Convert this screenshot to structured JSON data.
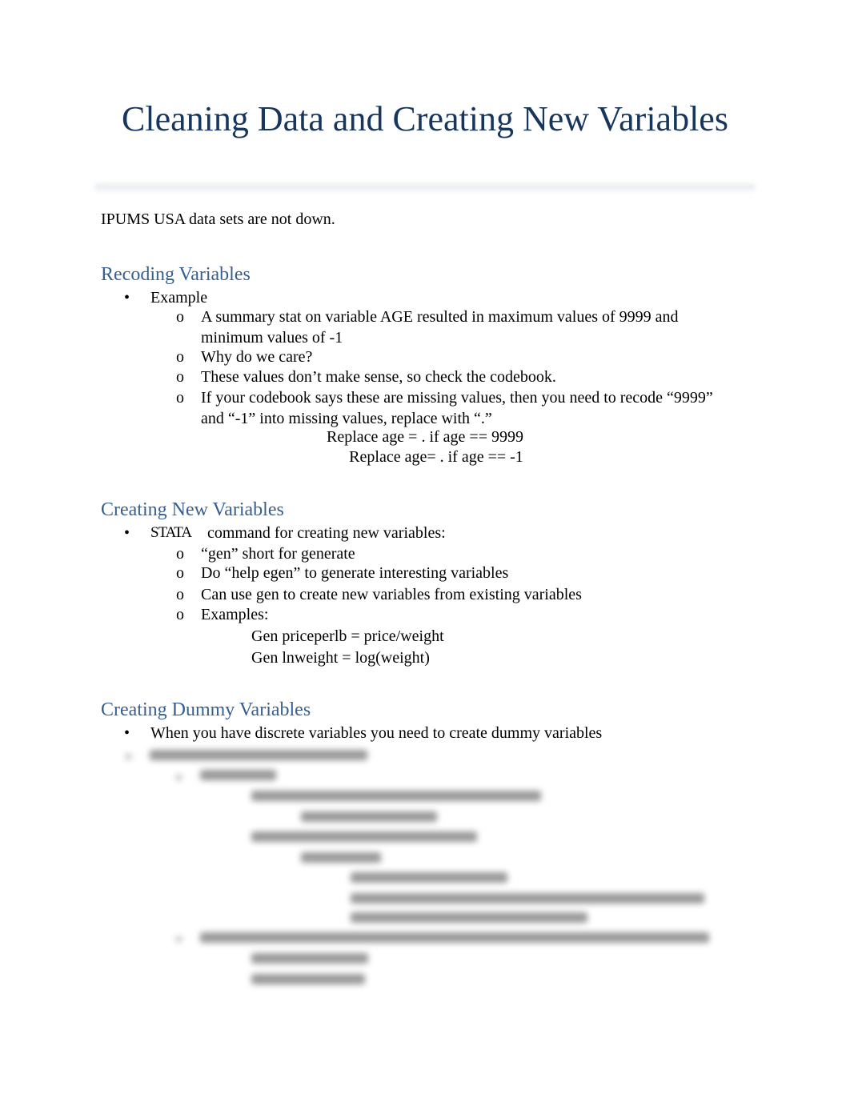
{
  "document": {
    "title": "Cleaning Data and Creating New Variables",
    "intro": "IPUMS USA data sets are not down.",
    "sections": [
      {
        "heading": "Recoding Variables",
        "bullet_glyph": "•",
        "sub_glyph": "o",
        "items": {
          "level1": "Example",
          "level2": [
            "A summary stat on variable AGE resulted in maximum values of 9999 and",
            "minimum values of -1",
            "Why do we care?",
            "These values don’t make sense, so check the codebook.",
            "If your codebook says these are missing values, then you need to recode “9999”",
            "and “-1” into missing values, replace with “.”"
          ],
          "code": [
            "Replace age = . if age == 9999",
            "Replace age= . if age == -1"
          ]
        }
      },
      {
        "heading": "Creating New Variables",
        "items": {
          "level1_a": "STATA",
          "level1_b": "command for creating new variables:",
          "level2": [
            "“gen” short for generate",
            "Do “help egen” to generate interesting variables",
            "Can use gen to create new variables from existing variables",
            "Examples:"
          ],
          "level3_glyph": "",
          "level3": [
            "Gen priceperlb = price/weight",
            "Gen lnweight = log(weight)"
          ]
        }
      },
      {
        "heading": "Creating Dummy Variables",
        "items": {
          "level1": "When you have discrete variables you need to create dummy variables"
        },
        "blurred_content_note": "remaining content blurred (preview locked)"
      }
    ]
  }
}
